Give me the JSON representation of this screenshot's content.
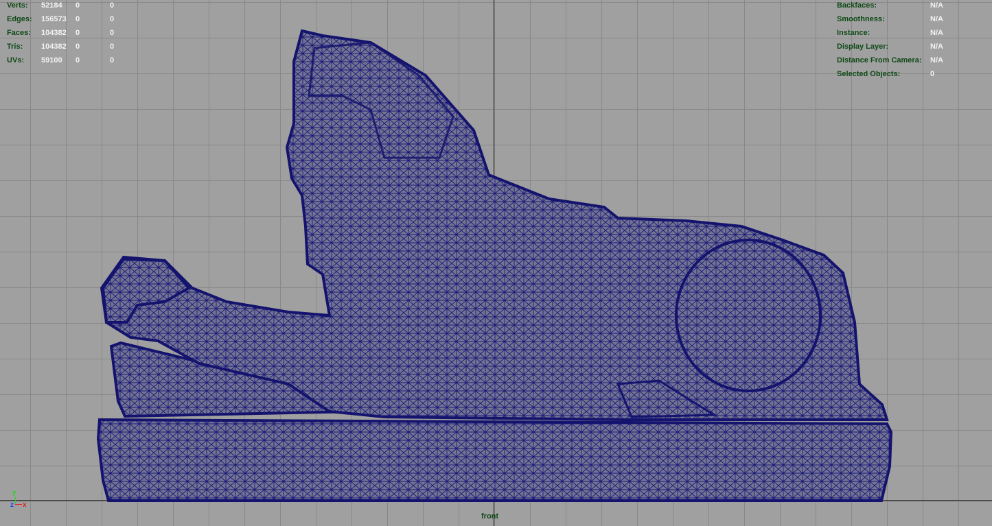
{
  "stats_left": [
    {
      "label": "Verts:",
      "v1": "52184",
      "v2": "0",
      "v3": "0"
    },
    {
      "label": "Edges:",
      "v1": "156573",
      "v2": "0",
      "v3": "0"
    },
    {
      "label": "Faces:",
      "v1": "104382",
      "v2": "0",
      "v3": "0"
    },
    {
      "label": "Tris:",
      "v1": "104382",
      "v2": "0",
      "v3": "0"
    },
    {
      "label": "UVs:",
      "v1": "59100",
      "v2": "0",
      "v3": "0"
    }
  ],
  "stats_right": [
    {
      "label": "Backfaces:",
      "value": "N/A"
    },
    {
      "label": "Smoothness:",
      "value": "N/A"
    },
    {
      "label": "Instance:",
      "value": "N/A"
    },
    {
      "label": "Display Layer:",
      "value": "N/A"
    },
    {
      "label": "Distance From Camera:",
      "value": "N/A"
    },
    {
      "label": "Selected Objects:",
      "value": "0"
    }
  ],
  "camera": {
    "name": "front"
  },
  "gizmo": {
    "y": "y",
    "z": "z",
    "x": "x"
  },
  "colors": {
    "background": "#a0a0a0",
    "grid": "#888888",
    "hud_label": "#0f4a16",
    "hud_value": "#f2f2f2",
    "wireframe": "#1a1a7a"
  }
}
